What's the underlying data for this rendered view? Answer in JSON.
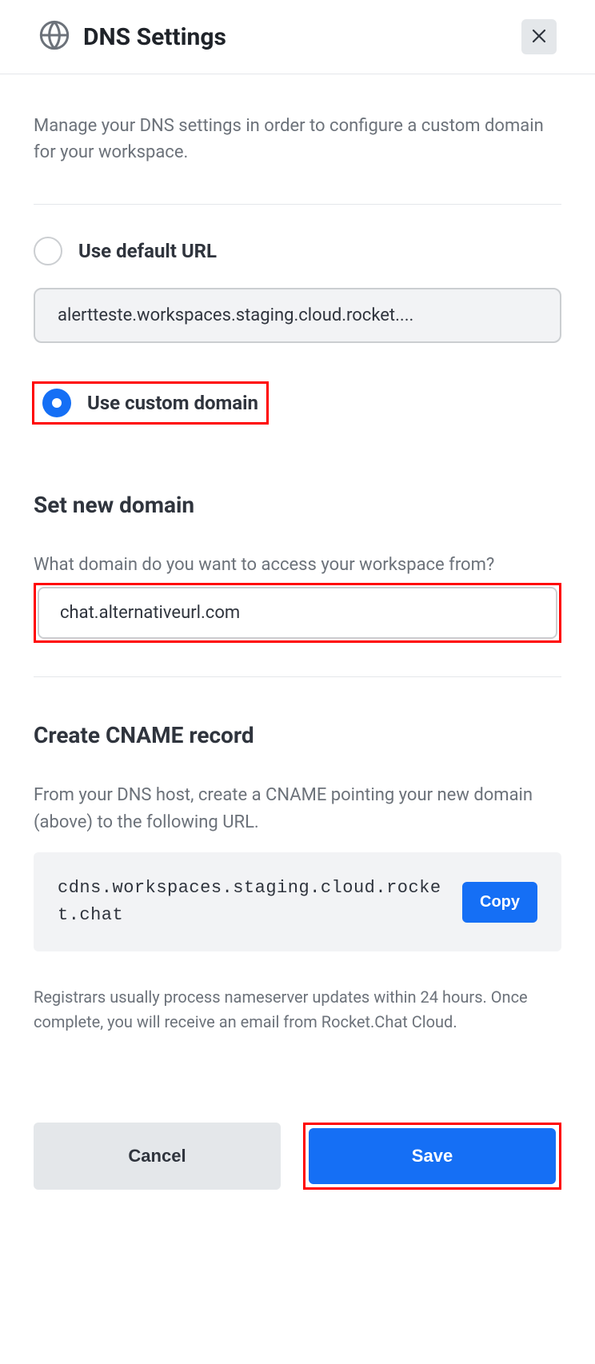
{
  "header": {
    "title": "DNS Settings"
  },
  "description": "Manage your DNS settings in order to configure a custom domain for your workspace.",
  "options": {
    "default": {
      "label": "Use default URL",
      "value": "alertteste.workspaces.staging.cloud.rocket...."
    },
    "custom": {
      "label": "Use custom domain"
    }
  },
  "set_domain": {
    "title": "Set new domain",
    "question": "What domain do you want to access your workspace from?",
    "value": "chat.alternativeurl.com"
  },
  "cname": {
    "title": "Create CNAME record",
    "description": "From your DNS host, create a CNAME pointing your new domain (above) to the following URL.",
    "url": "cdns.workspaces.staging.cloud.rocket.chat",
    "copy_label": "Copy",
    "note": "Registrars usually process nameserver updates within 24 hours. Once complete, you will receive an email from Rocket.Chat Cloud."
  },
  "footer": {
    "cancel": "Cancel",
    "save": "Save"
  }
}
